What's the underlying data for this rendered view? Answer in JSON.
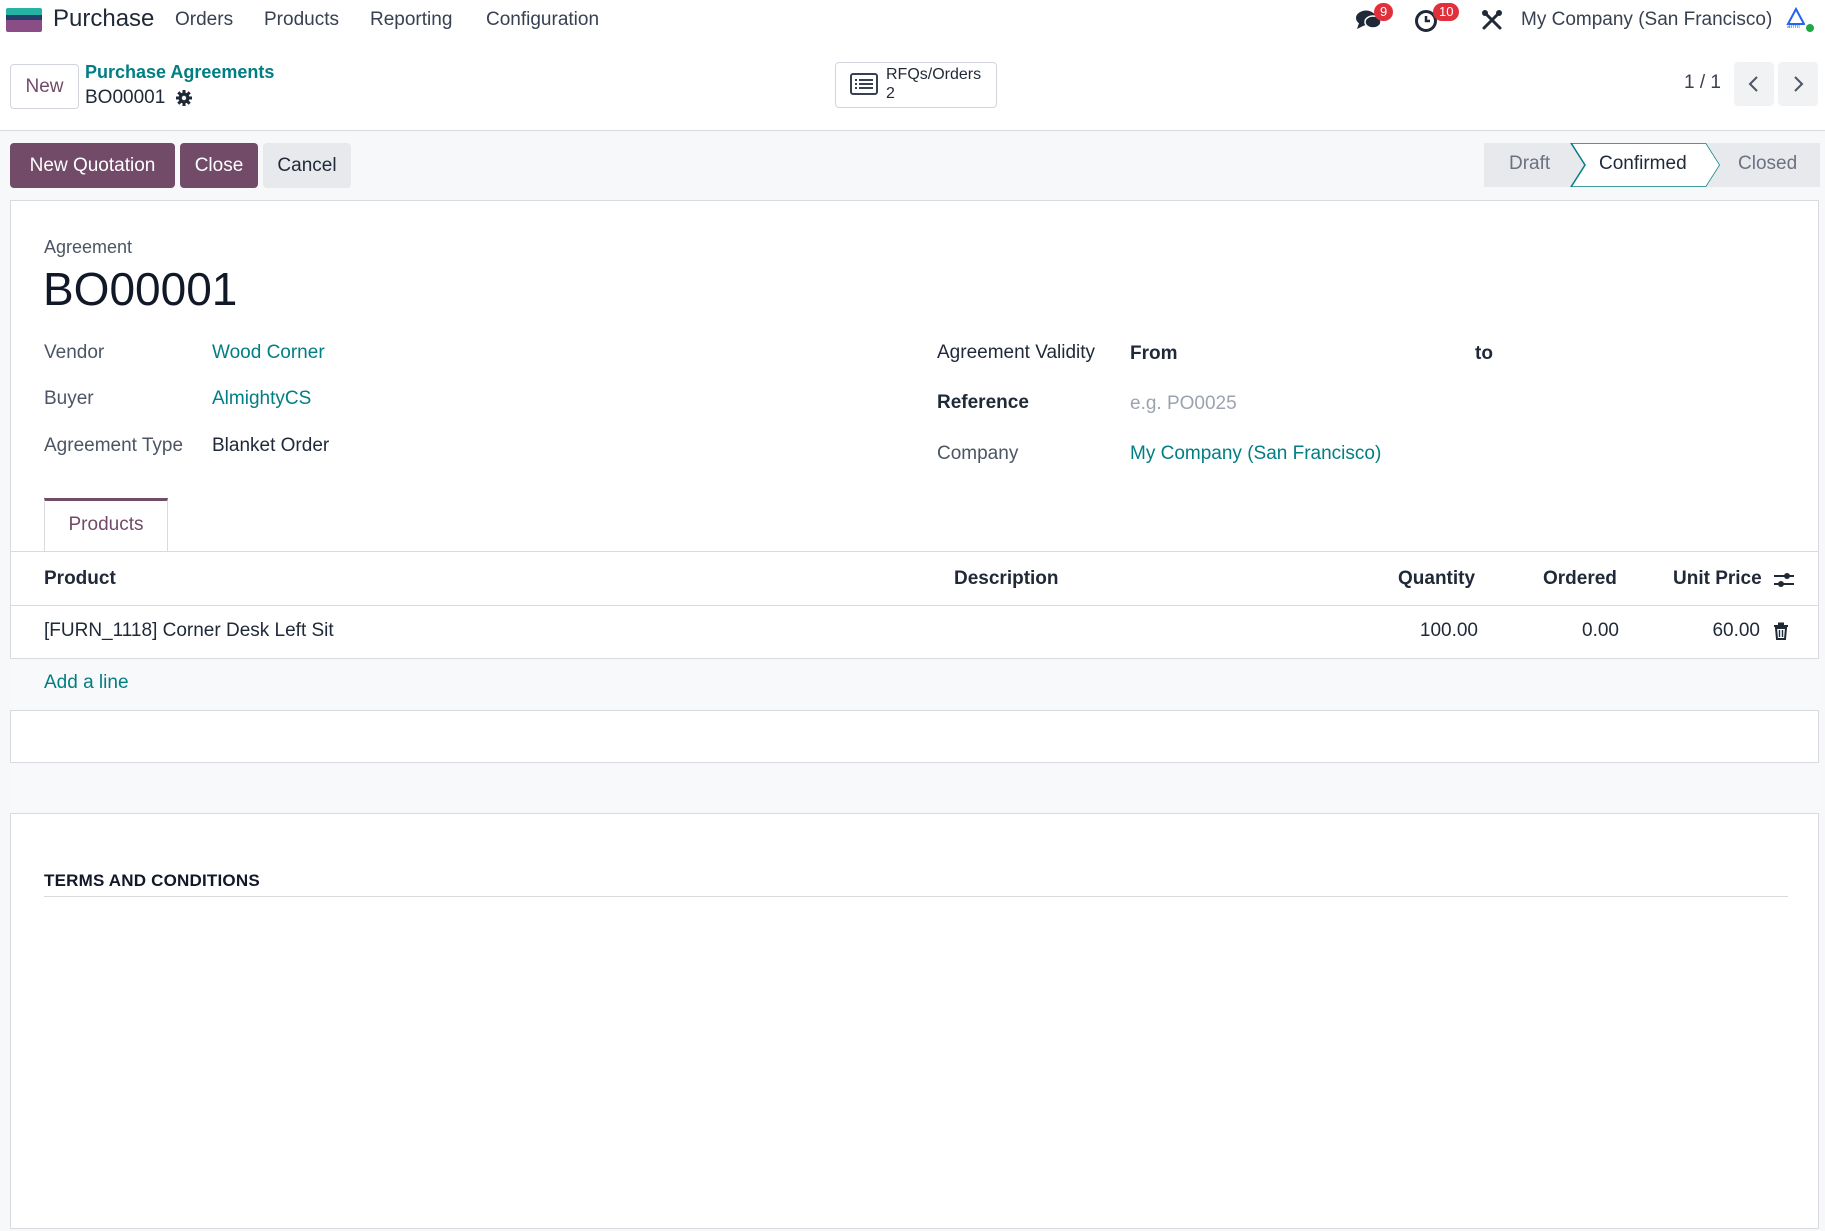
{
  "navbar": {
    "app_name": "Purchase",
    "menu": [
      "Orders",
      "Products",
      "Reporting",
      "Configuration"
    ],
    "messages_count": "9",
    "activities_count": "10",
    "company": "My Company (San Francisco)"
  },
  "control_panel": {
    "new_label": "New",
    "breadcrumb_parent": "Purchase Agreements",
    "record_name": "BO00001",
    "smart_button": {
      "label": "RFQs/Orders",
      "count": "2"
    },
    "pager": "1 / 1"
  },
  "actions": {
    "new_quotation": "New Quotation",
    "close": "Close",
    "cancel": "Cancel"
  },
  "status": {
    "stages": [
      "Draft",
      "Confirmed",
      "Closed"
    ],
    "current": "Confirmed"
  },
  "form": {
    "agreement_label": "Agreement",
    "agreement_name": "BO00001",
    "vendor": {
      "label": "Vendor",
      "value": "Wood Corner"
    },
    "buyer": {
      "label": "Buyer",
      "value": "AlmightyCS"
    },
    "agreement_type": {
      "label": "Agreement Type",
      "value": "Blanket Order"
    },
    "validity": {
      "label": "Agreement Validity",
      "from": "From",
      "to": "to"
    },
    "reference": {
      "label": "Reference",
      "placeholder": "e.g. PO0025"
    },
    "company": {
      "label": "Company",
      "value": "My Company (San Francisco)"
    }
  },
  "tabs": [
    "Products"
  ],
  "table": {
    "columns": [
      "Product",
      "Description",
      "Quantity",
      "Ordered",
      "Unit Price"
    ],
    "rows": [
      {
        "product": "[FURN_1118] Corner Desk Left Sit",
        "description": "",
        "quantity": "100.00",
        "ordered": "0.00",
        "unit_price": "60.00"
      }
    ],
    "add_line": "Add a line"
  },
  "terms_title": "TERMS AND CONDITIONS",
  "colors": {
    "primary": "#714b67",
    "link": "#017e84",
    "badge": "#e0303b"
  }
}
